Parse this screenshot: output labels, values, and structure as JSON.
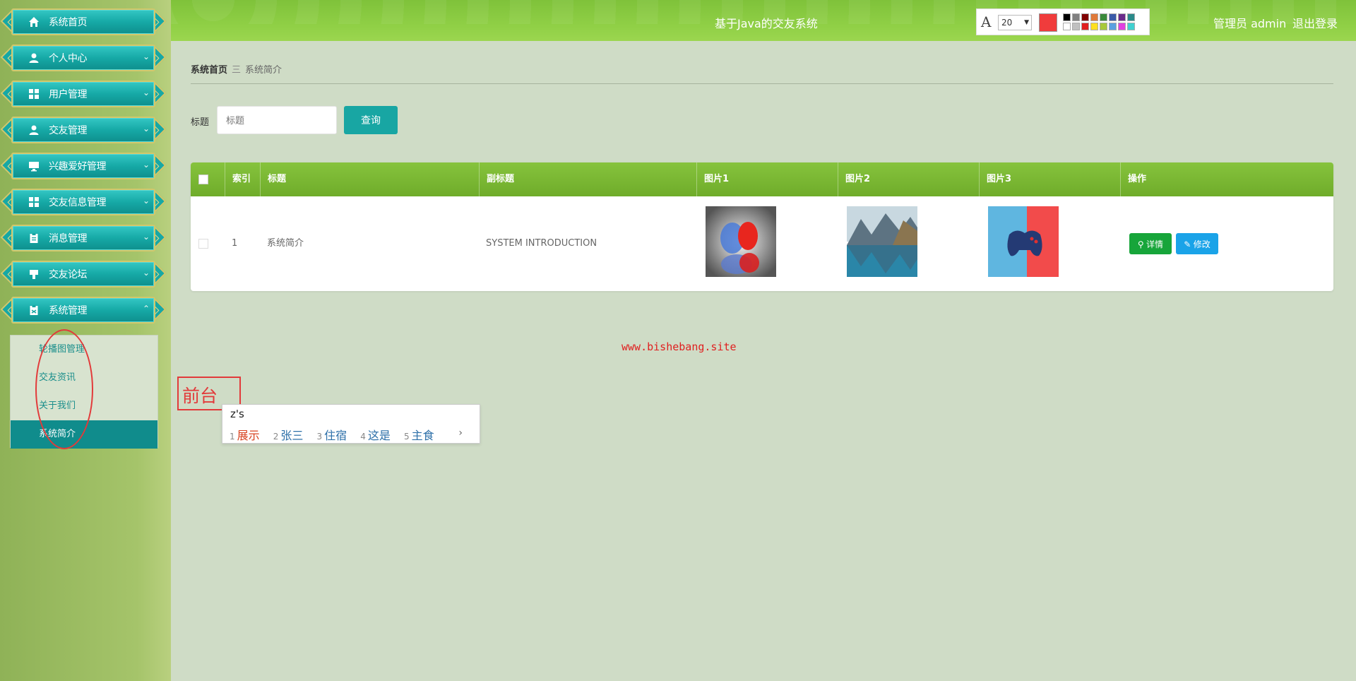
{
  "header": {
    "system_title": "基于Java的交友系统",
    "admin_label": "管理员 admin",
    "logout_label": "退出登录"
  },
  "sidebar": {
    "items": [
      {
        "label": "系统首页",
        "icon": "home-icon"
      },
      {
        "label": "个人中心",
        "icon": "user-icon"
      },
      {
        "label": "用户管理",
        "icon": "grid-icon"
      },
      {
        "label": "交友管理",
        "icon": "user-icon"
      },
      {
        "label": "兴趣爱好管理",
        "icon": "monitor-icon"
      },
      {
        "label": "交友信息管理",
        "icon": "grid-icon"
      },
      {
        "label": "消息管理",
        "icon": "clipboard-icon"
      },
      {
        "label": "交友论坛",
        "icon": "pin-icon"
      },
      {
        "label": "系统管理",
        "icon": "settings-icon"
      }
    ],
    "submenu": [
      {
        "label": "轮播图管理"
      },
      {
        "label": "交友资讯"
      },
      {
        "label": "关于我们"
      },
      {
        "label": "系统简介"
      }
    ]
  },
  "breadcrumb": {
    "home": "系统首页",
    "separator": "三",
    "current": "系统简介"
  },
  "search": {
    "label": "标题",
    "placeholder": "标题",
    "button": "查询"
  },
  "table": {
    "columns": [
      "索引",
      "标题",
      "副标题",
      "图片1",
      "图片2",
      "图片3",
      "操作"
    ],
    "rows": [
      {
        "index": "1",
        "title": "系统简介",
        "subtitle": "SYSTEM INTRODUCTION",
        "actions": {
          "detail": "详情",
          "edit": "修改"
        }
      }
    ]
  },
  "watermark": "www.bishebang.site",
  "annotation": {
    "frontend_label": "前台",
    "font_size": "20",
    "current_color": "#f03c3c",
    "palette": [
      "#000000",
      "#808080",
      "#800000",
      "#e07a3a",
      "#3a8a3a",
      "#3a5aa8",
      "#6a2a8a",
      "#2a8a8a",
      "#ffffff",
      "#c0c0c0",
      "#e02020",
      "#ffe020",
      "#a8c83a",
      "#5aa0e0",
      "#e040e0",
      "#40d0d0"
    ]
  },
  "ime": {
    "composition": "z's",
    "candidates": [
      {
        "num": "1",
        "text": "展示"
      },
      {
        "num": "2",
        "text": "张三"
      },
      {
        "num": "3",
        "text": "住宿"
      },
      {
        "num": "4",
        "text": "这是"
      },
      {
        "num": "5",
        "text": "主食"
      }
    ],
    "next": "›"
  }
}
